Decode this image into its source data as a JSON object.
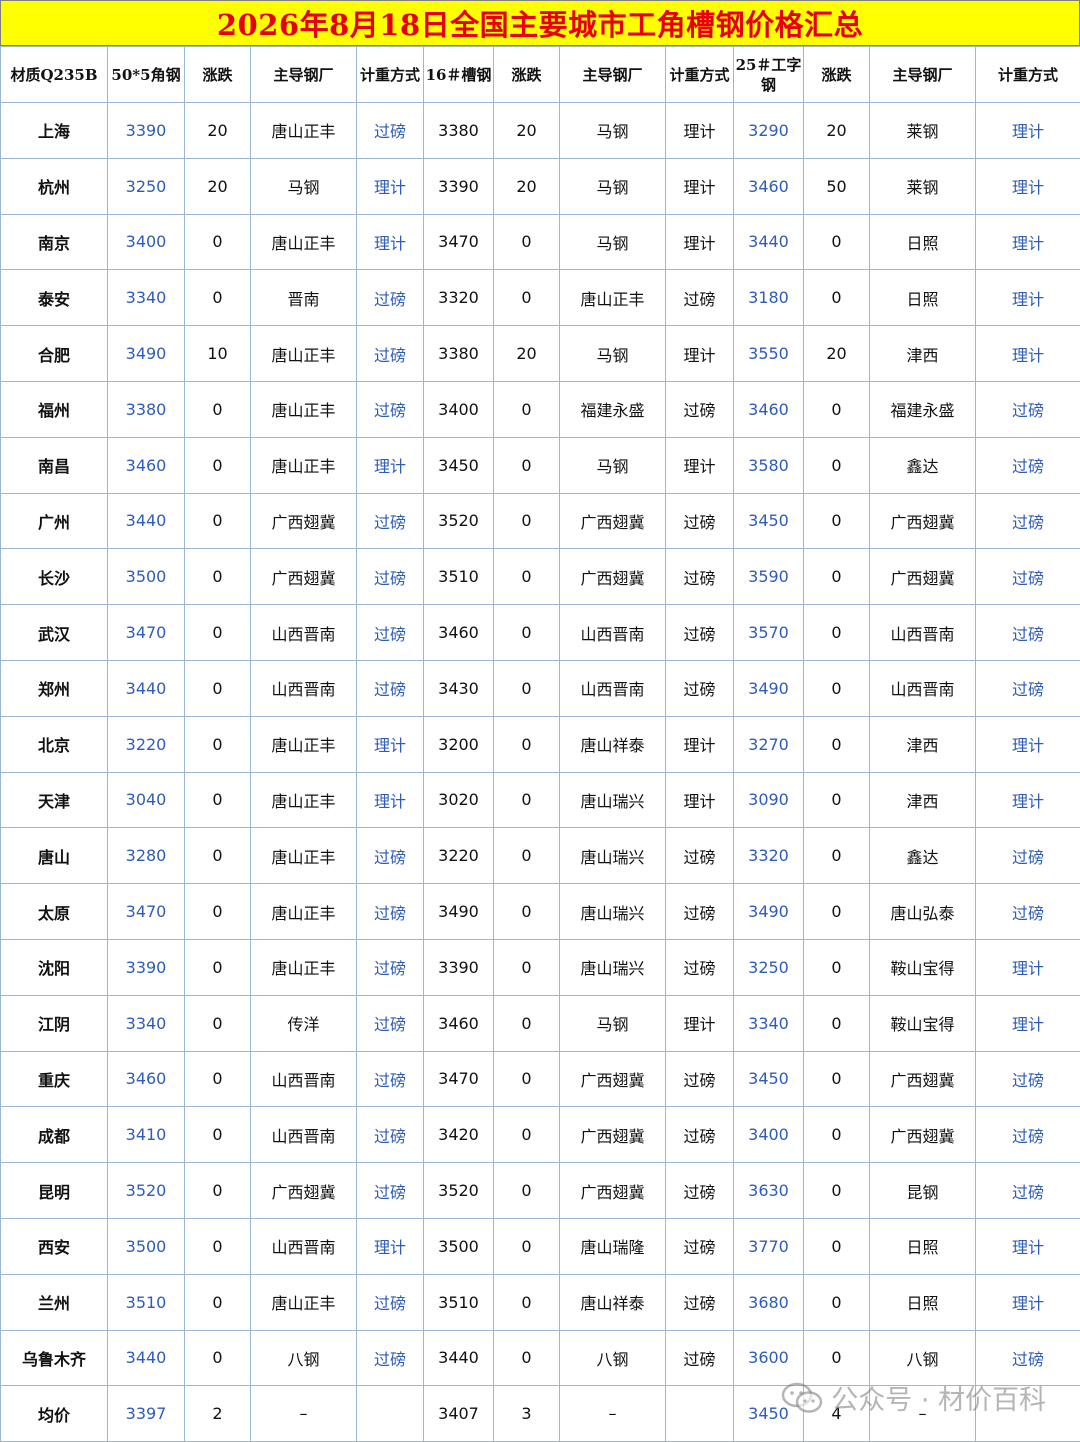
{
  "title": "2026年8月18日全国主要城市工角槽钢价格汇总",
  "colors": {
    "title_bg": "#ffff00",
    "title_text": "#e60012",
    "blue_text": "#2e5cb8",
    "grid": "#9bb7d4"
  },
  "headers": [
    "材质Q235B",
    "50*5角钢",
    "涨跌",
    "主导钢厂",
    "计重方式",
    "16＃槽钢",
    "涨跌",
    "主导钢厂",
    "计重方式",
    "25＃工字钢",
    "涨跌",
    "主导钢厂",
    "计重方式"
  ],
  "rows": [
    [
      "上海",
      "3390",
      "20",
      "唐山正丰",
      "过磅",
      "3380",
      "20",
      "马钢",
      "理计",
      "3290",
      "20",
      "莱钢",
      "理计"
    ],
    [
      "杭州",
      "3250",
      "20",
      "马钢",
      "理计",
      "3390",
      "20",
      "马钢",
      "理计",
      "3460",
      "50",
      "莱钢",
      "理计"
    ],
    [
      "南京",
      "3400",
      "0",
      "唐山正丰",
      "理计",
      "3470",
      "0",
      "马钢",
      "理计",
      "3440",
      "0",
      "日照",
      "理计"
    ],
    [
      "泰安",
      "3340",
      "0",
      "晋南",
      "过磅",
      "3320",
      "0",
      "唐山正丰",
      "过磅",
      "3180",
      "0",
      "日照",
      "理计"
    ],
    [
      "合肥",
      "3490",
      "10",
      "唐山正丰",
      "过磅",
      "3380",
      "20",
      "马钢",
      "理计",
      "3550",
      "20",
      "津西",
      "理计"
    ],
    [
      "福州",
      "3380",
      "0",
      "唐山正丰",
      "过磅",
      "3400",
      "0",
      "福建永盛",
      "过磅",
      "3460",
      "0",
      "福建永盛",
      "过磅"
    ],
    [
      "南昌",
      "3460",
      "0",
      "唐山正丰",
      "理计",
      "3450",
      "0",
      "马钢",
      "理计",
      "3580",
      "0",
      "鑫达",
      "过磅"
    ],
    [
      "广州",
      "3440",
      "0",
      "广西翅冀",
      "过磅",
      "3520",
      "0",
      "广西翅冀",
      "过磅",
      "3450",
      "0",
      "广西翅冀",
      "过磅"
    ],
    [
      "长沙",
      "3500",
      "0",
      "广西翅冀",
      "过磅",
      "3510",
      "0",
      "广西翅冀",
      "过磅",
      "3590",
      "0",
      "广西翅冀",
      "过磅"
    ],
    [
      "武汉",
      "3470",
      "0",
      "山西晋南",
      "过磅",
      "3460",
      "0",
      "山西晋南",
      "过磅",
      "3570",
      "0",
      "山西晋南",
      "过磅"
    ],
    [
      "郑州",
      "3440",
      "0",
      "山西晋南",
      "过磅",
      "3430",
      "0",
      "山西晋南",
      "过磅",
      "3490",
      "0",
      "山西晋南",
      "过磅"
    ],
    [
      "北京",
      "3220",
      "0",
      "唐山正丰",
      "理计",
      "3200",
      "0",
      "唐山祥泰",
      "理计",
      "3270",
      "0",
      "津西",
      "理计"
    ],
    [
      "天津",
      "3040",
      "0",
      "唐山正丰",
      "理计",
      "3020",
      "0",
      "唐山瑞兴",
      "理计",
      "3090",
      "0",
      "津西",
      "理计"
    ],
    [
      "唐山",
      "3280",
      "0",
      "唐山正丰",
      "过磅",
      "3220",
      "0",
      "唐山瑞兴",
      "过磅",
      "3320",
      "0",
      "鑫达",
      "过磅"
    ],
    [
      "太原",
      "3470",
      "0",
      "唐山正丰",
      "过磅",
      "3490",
      "0",
      "唐山瑞兴",
      "过磅",
      "3490",
      "0",
      "唐山弘泰",
      "过磅"
    ],
    [
      "沈阳",
      "3390",
      "0",
      "唐山正丰",
      "过磅",
      "3390",
      "0",
      "唐山瑞兴",
      "过磅",
      "3250",
      "0",
      "鞍山宝得",
      "理计"
    ],
    [
      "江阴",
      "3340",
      "0",
      "传洋",
      "过磅",
      "3460",
      "0",
      "马钢",
      "理计",
      "3340",
      "0",
      "鞍山宝得",
      "理计"
    ],
    [
      "重庆",
      "3460",
      "0",
      "山西晋南",
      "过磅",
      "3470",
      "0",
      "广西翅冀",
      "过磅",
      "3450",
      "0",
      "广西翅冀",
      "过磅"
    ],
    [
      "成都",
      "3410",
      "0",
      "山西晋南",
      "过磅",
      "3420",
      "0",
      "广西翅冀",
      "过磅",
      "3400",
      "0",
      "广西翅冀",
      "过磅"
    ],
    [
      "昆明",
      "3520",
      "0",
      "广西翅冀",
      "过磅",
      "3520",
      "0",
      "广西翅冀",
      "过磅",
      "3630",
      "0",
      "昆钢",
      "过磅"
    ],
    [
      "西安",
      "3500",
      "0",
      "山西晋南",
      "理计",
      "3500",
      "0",
      "唐山瑞隆",
      "过磅",
      "3770",
      "0",
      "日照",
      "理计"
    ],
    [
      "兰州",
      "3510",
      "0",
      "唐山正丰",
      "过磅",
      "3510",
      "0",
      "唐山祥泰",
      "过磅",
      "3680",
      "0",
      "日照",
      "理计"
    ],
    [
      "乌鲁木齐",
      "3440",
      "0",
      "八钢",
      "过磅",
      "3440",
      "0",
      "八钢",
      "过磅",
      "3600",
      "0",
      "八钢",
      "过磅"
    ],
    [
      "均价",
      "3397",
      "2",
      "–",
      "",
      "3407",
      "3",
      "–",
      "",
      "3450",
      "4",
      "–",
      ""
    ]
  ],
  "watermark": {
    "icon": "wechat-icon",
    "text": "公众号 · 材价百科"
  }
}
